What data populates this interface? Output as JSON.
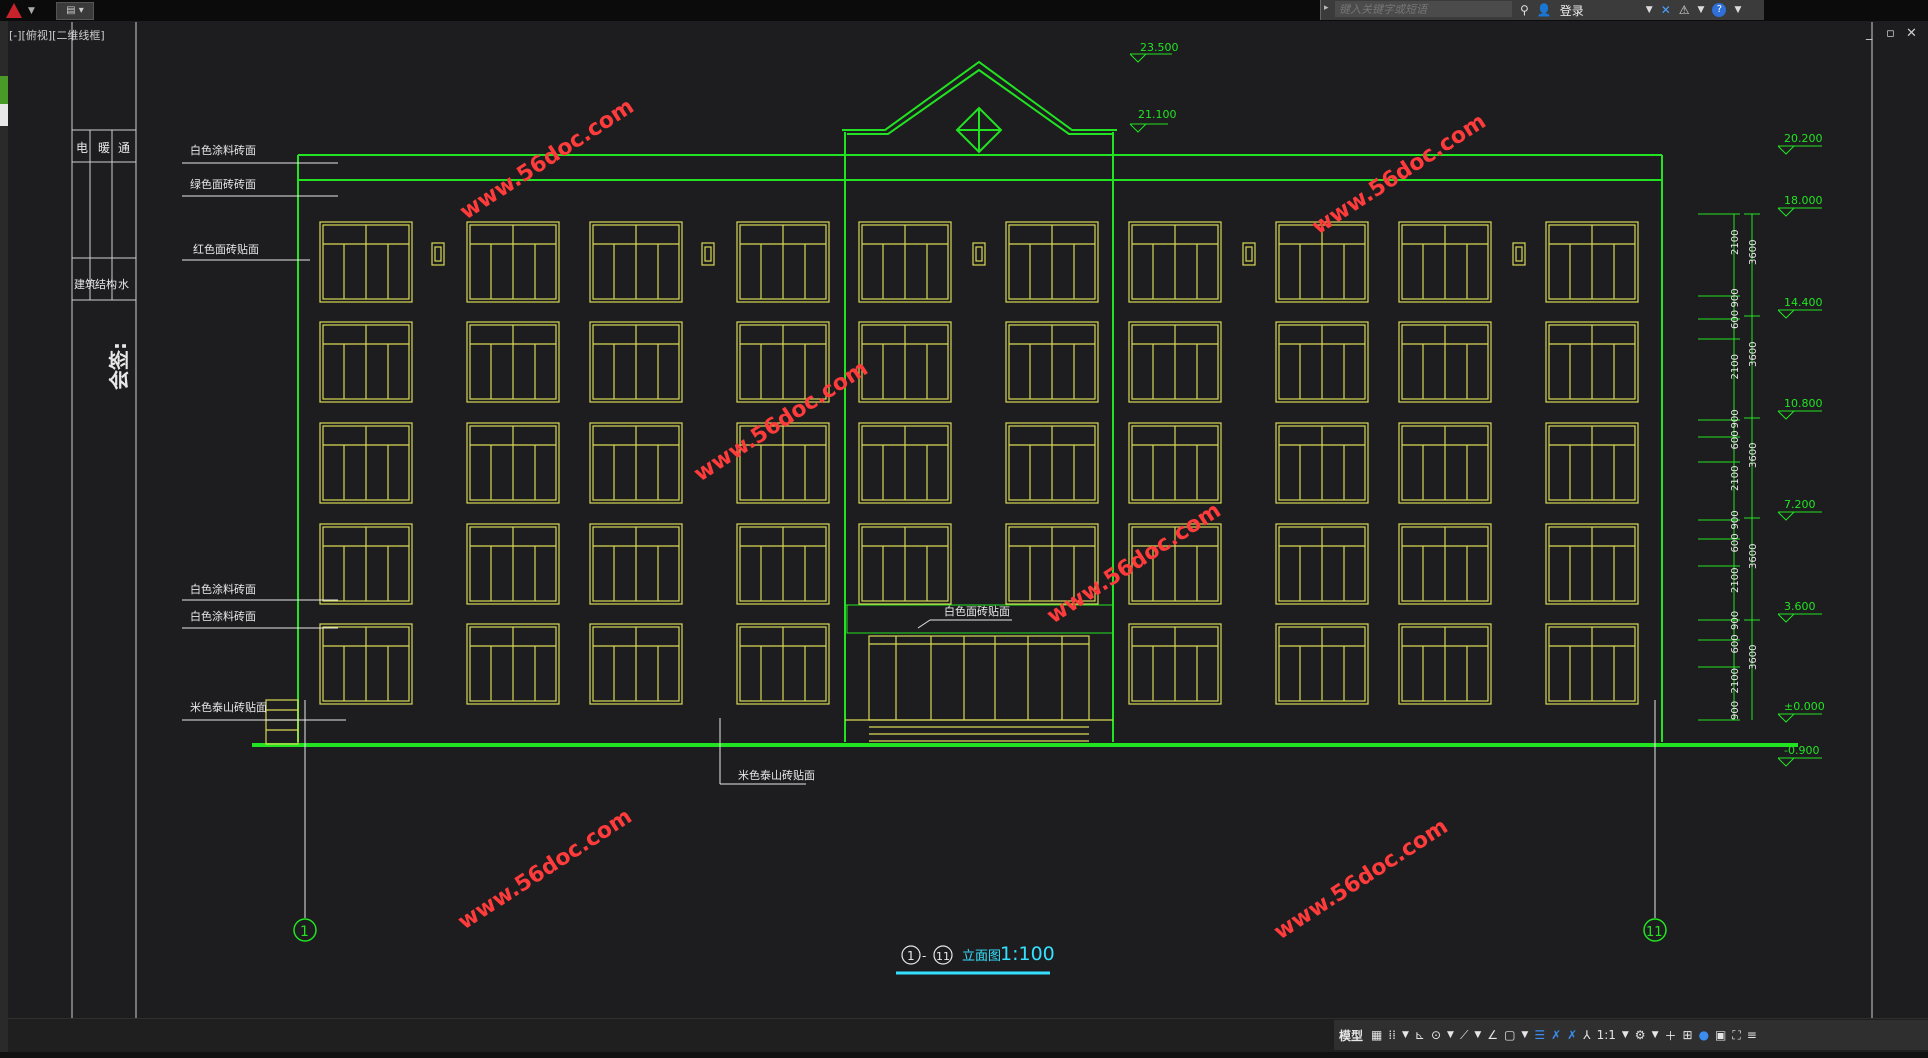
{
  "window": {
    "search_placeholder": "键入关键字或短语",
    "login_label": "登录",
    "layout_label": "[-][俯视][二维线框]",
    "qa_label": "▤ ▾"
  },
  "title_block": {
    "headers": [
      "电",
      "暖",
      "通"
    ],
    "disciplines": [
      "建筑",
      "结构",
      "水"
    ],
    "sign_label": "会签:"
  },
  "drawing": {
    "callouts_left": [
      {
        "text": "白色涂料砖面"
      },
      {
        "text": "绿色面砖砖面"
      },
      {
        "text": "红色面砖贴面"
      },
      {
        "text": "白色涂料砖面"
      },
      {
        "text": "白色涂料砖面"
      },
      {
        "text": "米色泰山砖贴面"
      }
    ],
    "callout_entrance": "白色面砖贴面",
    "callout_base": "米色泰山砖贴面",
    "elevations_top": [
      "23.500",
      "21.100"
    ],
    "elevations_right": [
      "20.200",
      "18.000",
      "14.400",
      "10.800",
      "7.200",
      "3.600",
      "±0.000",
      "-0.900"
    ],
    "dimensions_inner": [
      "2100",
      "900",
      "600",
      "2100",
      "900",
      "600",
      "2100",
      "900",
      "600",
      "2100",
      "900",
      "600",
      "2100",
      "900"
    ],
    "dimensions_outer": [
      "3600",
      "3600",
      "3600",
      "3600",
      "3600"
    ],
    "axis_left": "1",
    "axis_right": "11",
    "drawing_title_axis_left": "1",
    "drawing_title_axis_right": "11",
    "drawing_title_dash": "-",
    "drawing_title_name": "立面图",
    "drawing_title_scale": "1:100",
    "watermark": "www.56doc.com"
  },
  "status": {
    "model_label": "模型",
    "scale_label": "1:1"
  },
  "colors": {
    "background": "#1d1d1f",
    "outline_green": "#22e322",
    "window_yellow": "#d8d856",
    "text_white": "#e8e8e8",
    "watermark_red": "#ff3b3b",
    "title_cyan": "#35e0ff"
  }
}
